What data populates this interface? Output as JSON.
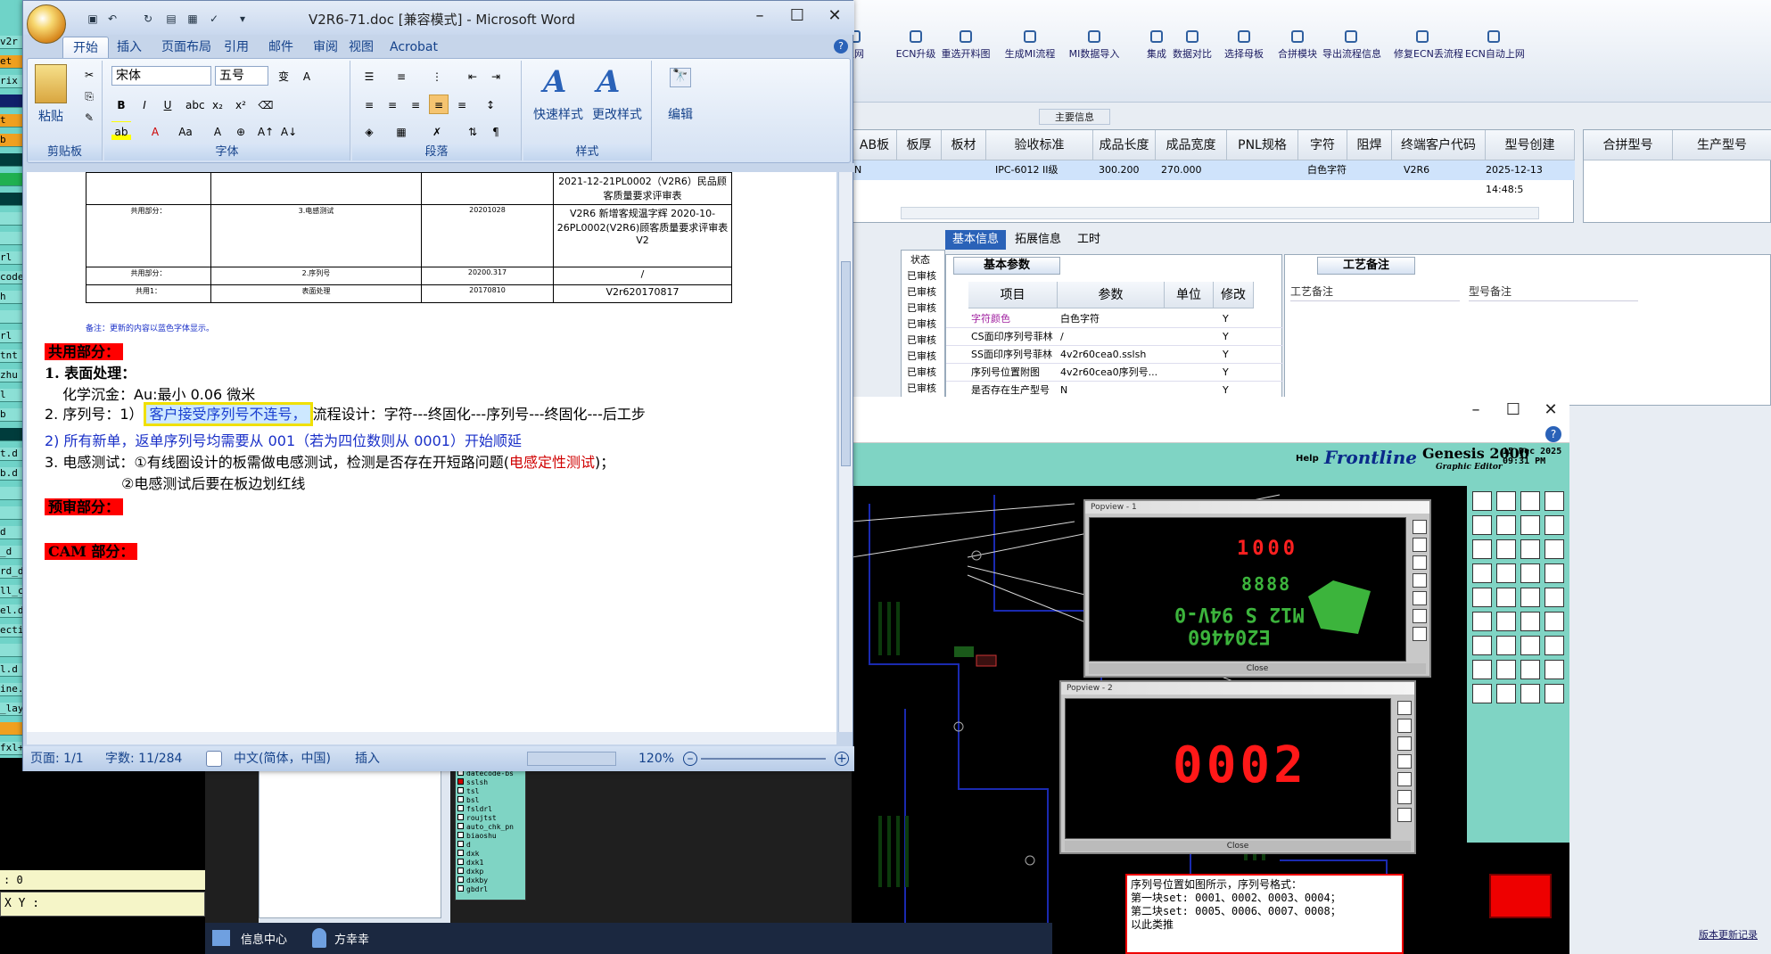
{
  "word": {
    "title": "V2R6-71.doc [兼容模式] - Microsoft Word",
    "tabs": [
      "开始",
      "插入",
      "页面布局",
      "引用",
      "邮件",
      "审阅",
      "视图",
      "Acrobat"
    ],
    "ribbon": {
      "paste_label": "粘贴",
      "clipboard_label": "剪贴板",
      "font_name": "宋体",
      "font_size": "五号",
      "font_group_label": "字体",
      "para_group_label": "段落",
      "quick_style_label": "快速样式",
      "change_style_label": "更改样式",
      "style_group_label": "样式",
      "edit_label": "编辑"
    },
    "table": {
      "rows": [
        {
          "c1": "",
          "c2": "",
          "c3": "",
          "c4": "2021-12-21PL0002（V2R6）民品顾客质量要求评审表"
        },
        {
          "c1": "共用部分：",
          "c2": "3.电感测试",
          "c3": "20201028",
          "c4": "V2R6 新增客规温字辉 2020-10-26PL0002(V2R6)顾客质量要求评审表 V2"
        },
        {
          "c1": "共用部分：",
          "c2": "2.序列号",
          "c3": "20200.317",
          "c4": "/"
        },
        {
          "c1": "共用1：",
          "c2": "表面处理",
          "c3": "20170810",
          "c4": "V2r620170817"
        }
      ],
      "note": "备注：更新的内容以蓝色字体显示。"
    },
    "doc": {
      "section_common": "共用部分：",
      "h1": "1. 表面处理：",
      "h1_line": "化学沉金：Au:最小 0.06 微米",
      "serial_prefix": "2. 序列号：1）",
      "serial_highlight": "客户接受序列号不连号，",
      "serial_suffix": "流程设计：字符---终固化---序列号---终固化---后工步",
      "serial_line2": "2) 所有新单，返单序列号均需要从 001（若为四位数则从 0001）开始顺延",
      "h3_prefix": "3. 电感测试：①有线圈设计的板需做电感测试，检测是否存在开短路问题(",
      "h3_red": "电感定性测试",
      "h3_suffix": ")；",
      "h3_line2": "②电感测试后要在板边划红线",
      "section_preaudit": "预审部分：",
      "section_cam": "CAM 部分："
    },
    "status": {
      "page": "页面: 1/1",
      "words": "字数: 11/284",
      "lang": "中文(简体，中国)",
      "mode": "插入",
      "zoom": "120%"
    }
  },
  "erp": {
    "toolbar": [
      "上网",
      "ECN升级",
      "重选开料图",
      "生成MI流程",
      "MI数据导入",
      "集成",
      "数据对比",
      "选择母板",
      "合拼模块",
      "导出流程信息",
      "修复ECN丢流程",
      "ECN自动上网"
    ],
    "section_label": "主要信息",
    "grid_headers": [
      "AB板",
      "板厚",
      "板材",
      "验收标准",
      "成品长度",
      "成品宽度",
      "PNL规格",
      "字符",
      "阻焊",
      "终端客户代码",
      "型号创建"
    ],
    "grid_row": {
      "flag": "N",
      "accept": "IPC-6012 II级",
      "len": "300.200",
      "wid": "270.000",
      "char": "白色字符",
      "cust": "V2R6",
      "created": "2025-12-13 14:48:5"
    },
    "right_headers": [
      "合拼型号",
      "生产型号"
    ],
    "tabs": [
      "基本信息",
      "拓展信息",
      "工时"
    ],
    "basic_title": "基本参数",
    "basic_headers": [
      "项目",
      "参数",
      "单位",
      "修改"
    ],
    "basic_rows": [
      {
        "item": "字符颜色",
        "param": "白色字符",
        "mod": "Y"
      },
      {
        "item": "CS面印序列号菲林",
        "param": "/",
        "mod": "Y"
      },
      {
        "item": "SS面印序列号菲林",
        "param": "4v2r60cea0.sslsh",
        "mod": "Y"
      },
      {
        "item": "序列号位置附图",
        "param": "4v2r60cea0序列号...",
        "mod": "Y"
      },
      {
        "item": "是否存在生产型号",
        "param": "N",
        "mod": "Y"
      }
    ],
    "status_col_header": "状态",
    "status_values": [
      "已审核",
      "已审核",
      "已审核",
      "已审核",
      "已审核",
      "已审核",
      "已审核",
      "已审核"
    ],
    "craft_title": "工艺备注",
    "craft_headers": [
      "工艺备注",
      "型号备注"
    ],
    "footer_link": "版本更新记录"
  },
  "genesis": {
    "help": "Help",
    "brand": "Frontline",
    "product": "Genesis 2000",
    "subtitle": "Graphic Editor",
    "date_line1": "15 Dec 2025",
    "date_line2": "09:31 PM",
    "popview1_title": "Popview - 1",
    "popview1_top": "1000",
    "popview1_mid": "8888",
    "popview1_code": "E204460",
    "popview1_mark": "M12 S 94V-0",
    "popview2_title": "Popview - 2",
    "popview2_value": "0002",
    "close_label": "Close",
    "note_lines": [
      "序列号位置如图所示，序列号格式：",
      "第一块set: 0001、0002、0003、0004；",
      "第二块set: 0005、0006、0007、0008；",
      "以此类推"
    ]
  },
  "cam": {
    "layers": [
      "datecode-bs",
      "sslsh",
      "tsl",
      "bsl",
      "fsldrl",
      "roujtst",
      "auto_chk_pn",
      "biaoshu",
      "d",
      "dxk",
      "dxk1",
      "dxkp",
      "dxkby",
      "gbdrl"
    ],
    "coord": "0",
    "xy_label": "X Y :",
    "tray": {
      "info_center": "信息中心",
      "user": "方幸幸"
    },
    "left_labels": [
      "v2r",
      "et",
      "rix",
      "",
      "t",
      "b",
      "",
      "",
      "",
      "",
      "",
      "rl",
      "code",
      "h",
      "",
      "rl",
      "tnt",
      "zhu",
      "l",
      "b",
      "",
      "t.d",
      "b.d",
      "",
      "",
      "d",
      "_d",
      "rd_d",
      "ll_c",
      "el.d",
      "ecti",
      "",
      "l.d",
      "ine.",
      "_layer_l",
      "",
      "fxl+++"
    ]
  },
  "colors": {
    "accent": "#2a62b8",
    "highlight_border": "#f0e000",
    "red_label": "#ff0000",
    "cam_bg": "#7fd4c4"
  }
}
